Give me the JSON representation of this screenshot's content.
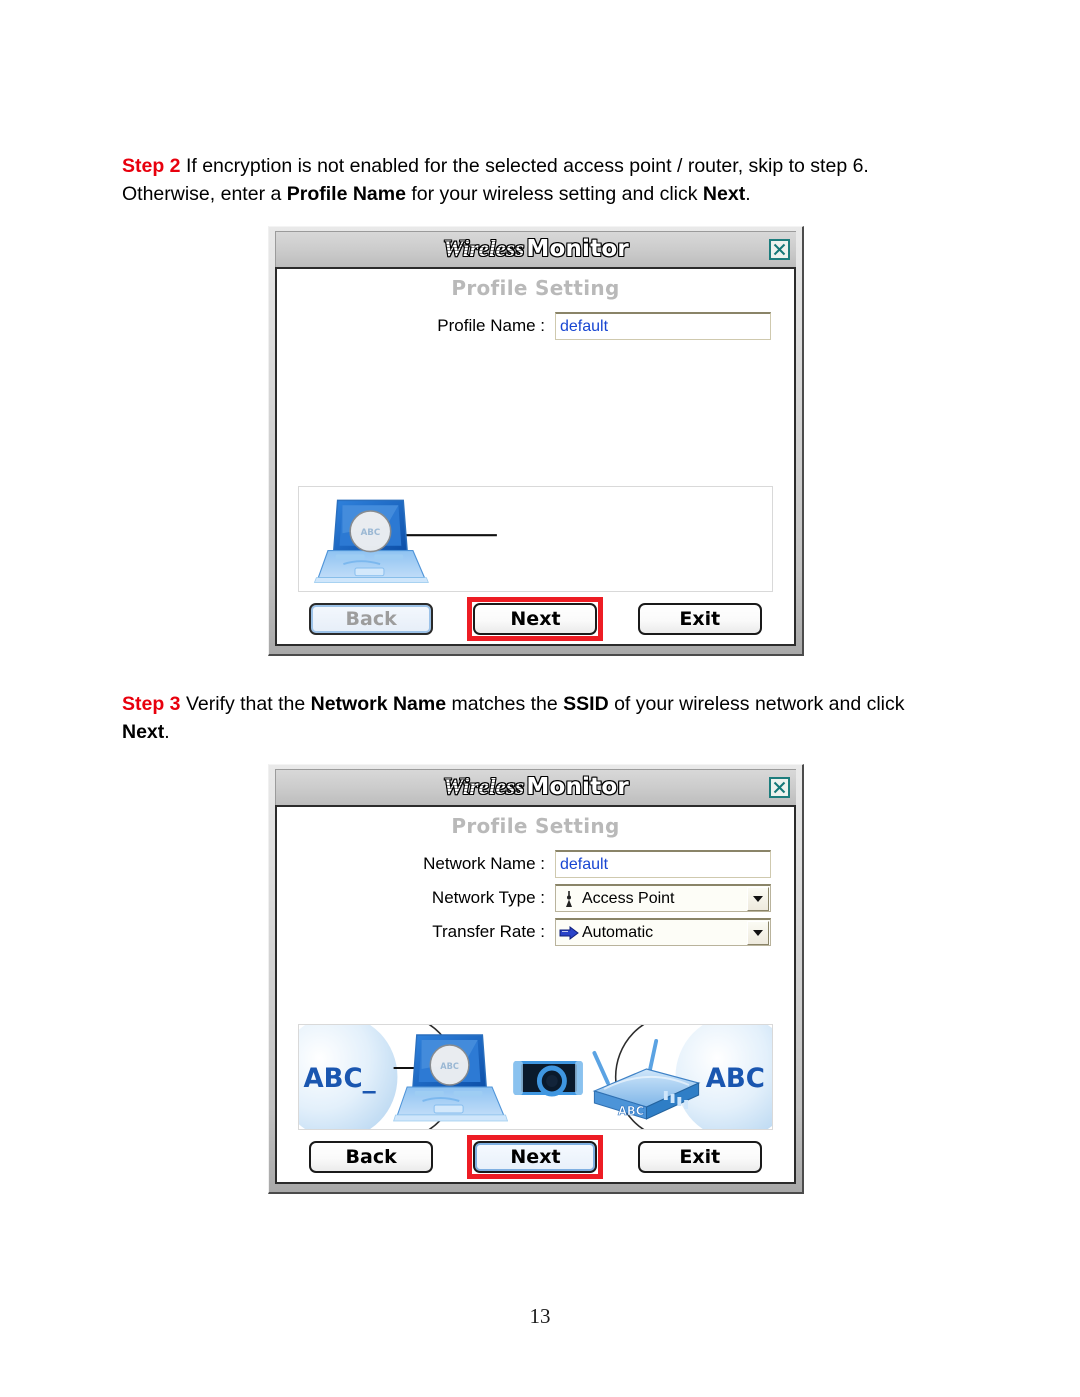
{
  "document": {
    "page_number": "13",
    "steps": [
      {
        "label": "Step 2",
        "text_parts": [
          {
            "t": " If encryption is not enabled for the selected access point / router, skip to step 6. Otherwise, enter a ",
            "bold": false
          },
          {
            "t": "Profile Name",
            "bold": true
          },
          {
            "t": " for your wireless setting and click ",
            "bold": false
          },
          {
            "t": "Next",
            "bold": true
          },
          {
            "t": ".",
            "bold": false
          }
        ]
      },
      {
        "label": "Step 3",
        "text_parts": [
          {
            "t": " Verify that the ",
            "bold": false
          },
          {
            "t": "Network Name",
            "bold": true
          },
          {
            "t": " matches the ",
            "bold": false
          },
          {
            "t": "SSID",
            "bold": true
          },
          {
            "t": " of your wireless network and click ",
            "bold": false
          },
          {
            "t": "Next",
            "bold": true
          },
          {
            "t": ".",
            "bold": false
          }
        ]
      }
    ]
  },
  "dialog1": {
    "title_part1": "Wireless",
    "title_part2": "Monitor",
    "close_label": "×",
    "panel_heading": "Profile Setting",
    "fields": [
      {
        "label": "Profile Name :",
        "kind": "text",
        "value": "default"
      }
    ],
    "illustration": {
      "type": "laptop-with-magnifier-and-line",
      "magnifier_text": "ABC"
    },
    "buttons": [
      {
        "label": "Back",
        "state": "disabled",
        "highlighted": false
      },
      {
        "label": "Next",
        "state": "normal",
        "highlighted": true
      },
      {
        "label": "Exit",
        "state": "normal",
        "highlighted": false
      }
    ]
  },
  "dialog2": {
    "title_part1": "Wireless",
    "title_part2": "Monitor",
    "close_label": "×",
    "panel_heading": "Profile Setting",
    "fields": [
      {
        "label": "Network Name :",
        "kind": "text",
        "value": "default"
      },
      {
        "label": "Network Type :",
        "kind": "combo",
        "value": "Access Point",
        "icon": "access-point-icon"
      },
      {
        "label": "Transfer Rate :",
        "kind": "combo",
        "value": "Automatic",
        "icon": "transfer-arrow-icon"
      }
    ],
    "illustration": {
      "type": "network-topology",
      "left_label": "ABC_",
      "right_label": "ABC",
      "router_label": "ABC",
      "magnifier_text": "ABC"
    },
    "buttons": [
      {
        "label": "Back",
        "state": "normal",
        "highlighted": false
      },
      {
        "label": "Next",
        "state": "focused",
        "highlighted": true
      },
      {
        "label": "Exit",
        "state": "normal",
        "highlighted": false
      }
    ]
  },
  "colors": {
    "step_label_red": "#e8000d",
    "highlight_red": "#ed1c24",
    "input_value_blue": "#1846d2",
    "panel_heading_gray": "#b9b9b9",
    "close_teal": "#1d7d7d",
    "illustration_blue": "#1668c8"
  }
}
